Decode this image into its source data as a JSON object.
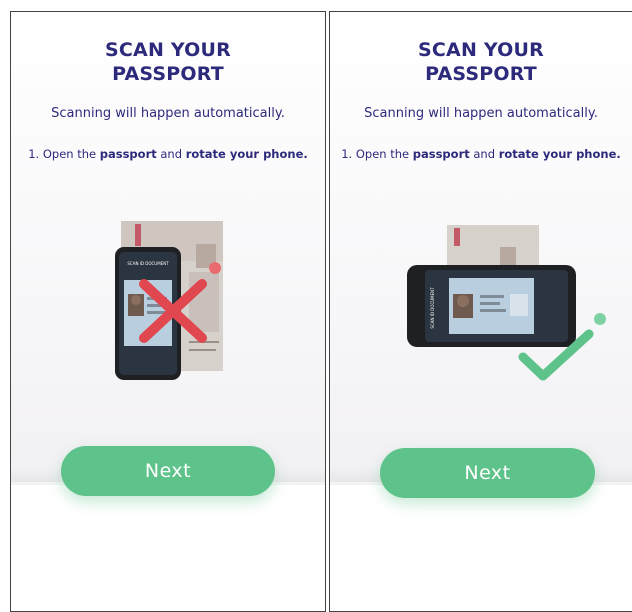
{
  "screens": [
    {
      "title": "SCAN YOUR PASSPORT",
      "subtitle": "Scanning will happen automatically.",
      "step_prefix": "1. Open the ",
      "step_bold1": "passport",
      "step_mid": " and ",
      "step_bold2": "rotate your phone.",
      "phone_header": "SCAN ID DOCUMENT",
      "indicator": "cross",
      "button_label": "Next"
    },
    {
      "title": "SCAN YOUR PASSPORT",
      "subtitle": "Scanning will happen automatically.",
      "step_prefix": "1. Open the ",
      "step_bold1": "passport",
      "step_mid": " and ",
      "step_bold2": "rotate your phone.",
      "phone_header": "SCAN ID DOCUMENT",
      "indicator": "check",
      "button_label": "Next"
    }
  ],
  "colors": {
    "title": "#2d2a7c",
    "button": "#5ec38a",
    "cross": "#e0474f",
    "check": "#5ec38a"
  }
}
